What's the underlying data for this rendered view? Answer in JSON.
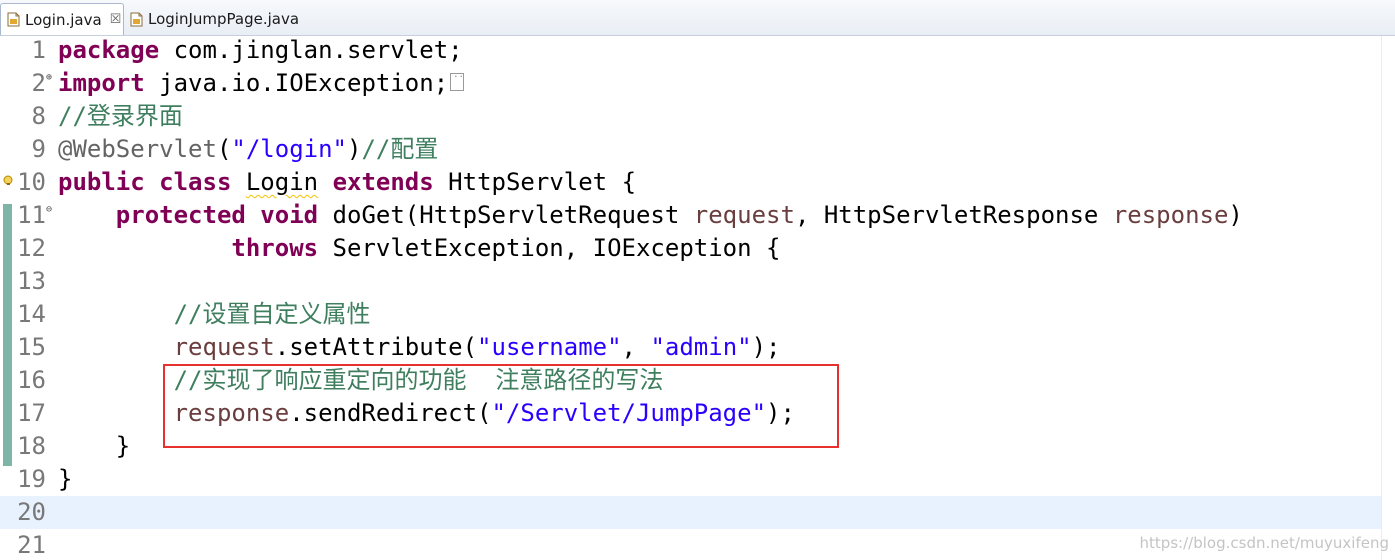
{
  "tabs": [
    {
      "label": "Login.java",
      "close": "☒",
      "active": true
    },
    {
      "label": "LoginJumpPage.java",
      "active": false
    }
  ],
  "lines": [
    {
      "num": "1",
      "tokens": [
        [
          "kw",
          "package"
        ],
        [
          "",
          "com.jinglan.servlet;"
        ]
      ]
    },
    {
      "num": "2",
      "fold": "⊕",
      "tokens": [
        [
          "kw",
          "import"
        ],
        [
          "",
          "java.io.IOException;"
        ]
      ],
      "collapsed": true
    },
    {
      "num": "8",
      "tokens": [
        [
          "cm",
          "//登录界面"
        ]
      ]
    },
    {
      "num": "9",
      "tokens": [
        [
          "ann",
          "@WebServlet"
        ],
        [
          "",
          "("
        ],
        [
          "str",
          "\"/login\""
        ],
        [
          "",
          ")"
        ],
        [
          "cm",
          "//配置"
        ]
      ]
    },
    {
      "num": "10",
      "warn": true,
      "tokens": [
        [
          "kw",
          "public"
        ],
        [
          "kw",
          "class"
        ],
        [
          "sq",
          "Login"
        ],
        [
          "kw",
          "extends"
        ],
        [
          "",
          "HttpServlet {"
        ]
      ]
    },
    {
      "num": "11",
      "fold": "⊖",
      "tokens": [
        [
          "",
          "    "
        ],
        [
          "kw",
          "protected"
        ],
        [
          "kw",
          "void"
        ],
        [
          "",
          "doGet(HttpServletRequest "
        ],
        [
          "param",
          "request"
        ],
        [
          "",
          ", HttpServletResponse "
        ],
        [
          "param",
          "response"
        ],
        [
          "",
          ")"
        ]
      ]
    },
    {
      "num": "12",
      "tokens": [
        [
          "",
          "            "
        ],
        [
          "kw",
          "throws"
        ],
        [
          "",
          "ServletException, IOException {"
        ]
      ]
    },
    {
      "num": "13",
      "tokens": []
    },
    {
      "num": "14",
      "tokens": [
        [
          "",
          "        "
        ],
        [
          "cm",
          "//设置自定义属性"
        ]
      ]
    },
    {
      "num": "15",
      "tokens": [
        [
          "",
          "        "
        ],
        [
          "param",
          "request"
        ],
        [
          "",
          ".setAttribute("
        ],
        [
          "str",
          "\"username\""
        ],
        [
          "",
          ", "
        ],
        [
          "str",
          "\"admin\""
        ],
        [
          "",
          ");"
        ]
      ]
    },
    {
      "num": "16",
      "tokens": [
        [
          "",
          "        "
        ],
        [
          "cm",
          "//实现了响应重定向的功能  注意路径的写法"
        ]
      ]
    },
    {
      "num": "17",
      "tokens": [
        [
          "",
          "        "
        ],
        [
          "param",
          "response"
        ],
        [
          "",
          ".sendRedirect("
        ],
        [
          "str",
          "\"/Servlet/JumpPage\""
        ],
        [
          "",
          ");"
        ]
      ]
    },
    {
      "num": "18",
      "tokens": [
        [
          "",
          "    }"
        ]
      ]
    },
    {
      "num": "19",
      "tokens": [
        [
          "",
          "}"
        ]
      ]
    },
    {
      "num": "20",
      "current": true,
      "tokens": []
    },
    {
      "num": "21",
      "tokens": []
    }
  ],
  "watermark": "https://blog.csdn.net/muyuxifeng",
  "colors": {
    "keyword": "#7f0055",
    "string": "#2a00ff",
    "comment": "#3f7f5f",
    "annotation": "#646464",
    "parameter": "#6a3e3e",
    "highlight_box": "#e8312f",
    "current_line": "#e8f2fe"
  }
}
